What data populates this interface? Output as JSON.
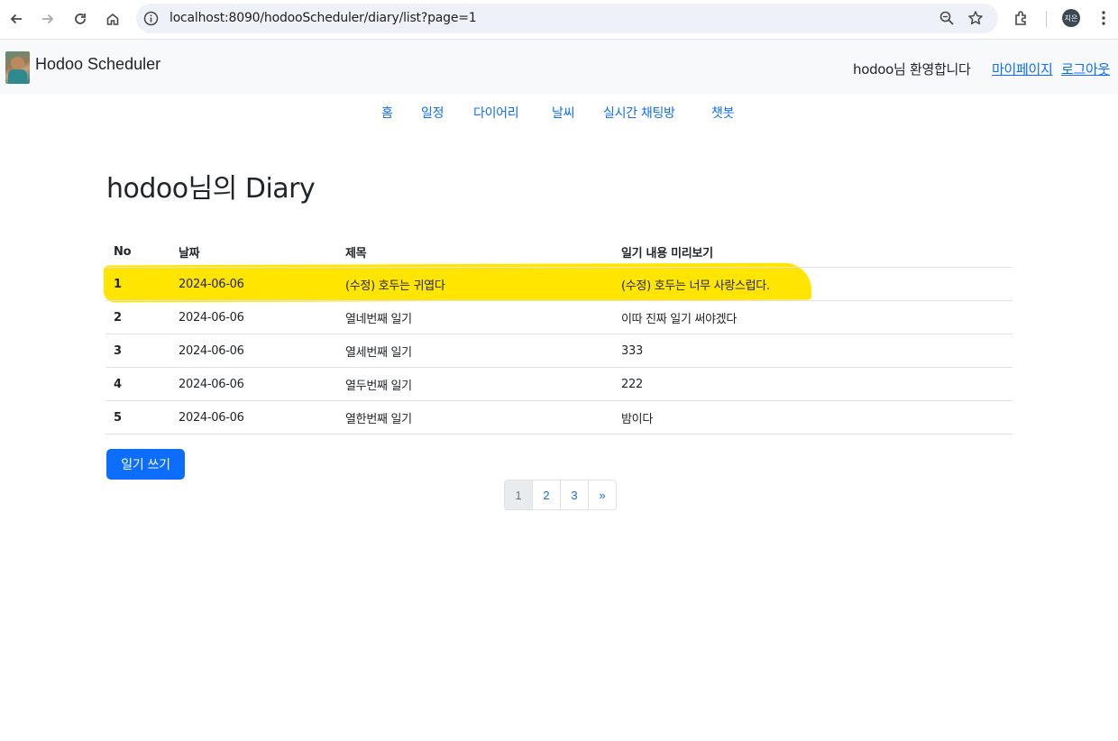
{
  "browser": {
    "url": "localhost:8090/hodooScheduler/diary/list?page=1",
    "profile_initials": "지은"
  },
  "header": {
    "brand": "Hodoo Scheduler",
    "welcome": "hodoo님 환영합니다",
    "mypage": "마이페이지",
    "logout": "로그아웃"
  },
  "menu": [
    "홈",
    "일정",
    "다이어리",
    "날씨",
    "실시간 채팅방",
    "챗봇"
  ],
  "page": {
    "title": "hodoo님의 Diary"
  },
  "table": {
    "headers": [
      "No",
      "날짜",
      "제목",
      "일기 내용 미리보기"
    ],
    "rows": [
      [
        "1",
        "2024-06-06",
        "(수정) 호두는 귀엽다",
        "(수정) 호두는 너무 사랑스럽다."
      ],
      [
        "2",
        "2024-06-06",
        "열네번째 일기",
        "이따 진짜 일기 써야겠다"
      ],
      [
        "3",
        "2024-06-06",
        "열세번째 일기",
        "333"
      ],
      [
        "4",
        "2024-06-06",
        "열두번째 일기",
        "222"
      ],
      [
        "5",
        "2024-06-06",
        "열한번째 일기",
        "밤이다"
      ]
    ]
  },
  "write_button": "일기 쓰기",
  "pagination": [
    "1",
    "2",
    "3",
    "»"
  ],
  "colors": {
    "accent": "#0d6efd",
    "highlight": "#ffe500"
  }
}
